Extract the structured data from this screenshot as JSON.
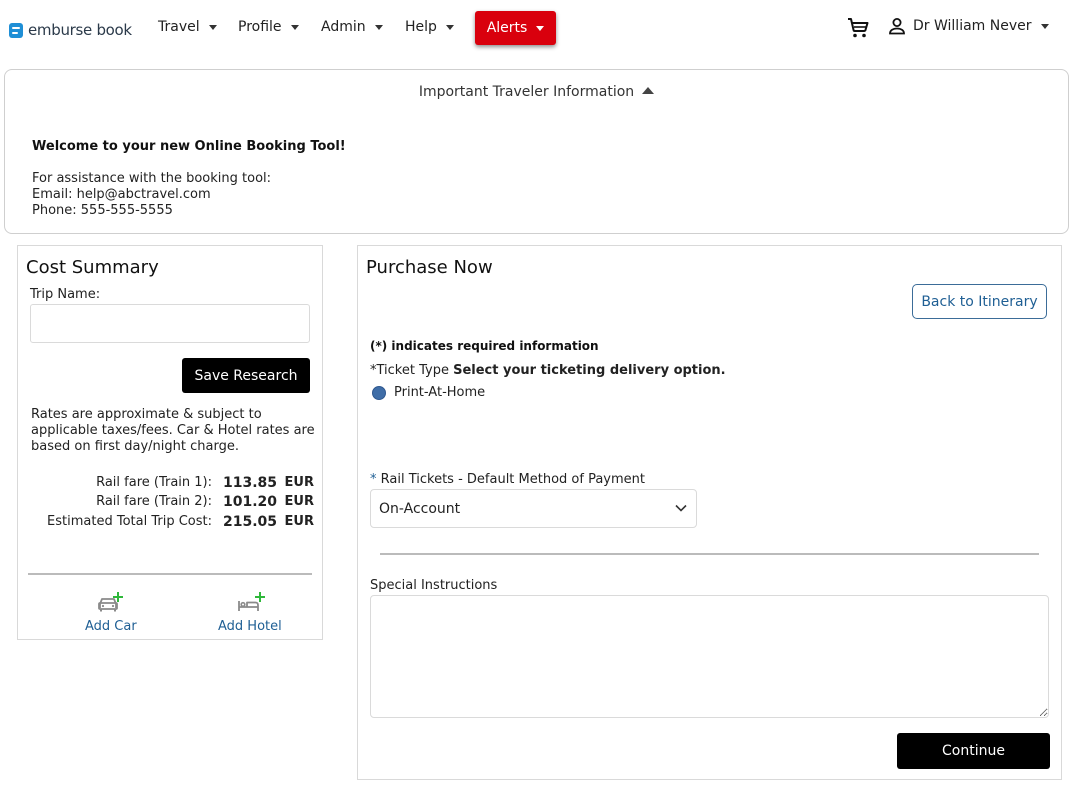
{
  "nav": {
    "logo_brand": "emburse",
    "logo_product": "book",
    "menu": [
      "Travel",
      "Profile",
      "Admin",
      "Help"
    ],
    "alerts_label": "Alerts",
    "user_name": "Dr William Never"
  },
  "info": {
    "title": "Important Traveler Information",
    "welcome": "Welcome to your new Online Booking Tool!",
    "assist_line": "For assistance with the booking tool:",
    "email_line": "Email:  help@abctravel.com",
    "phone_line": "Phone:  555-555-5555"
  },
  "cost_summary": {
    "title": "Cost Summary",
    "trip_name_label": "Trip Name:",
    "trip_name_value": "",
    "save_label": "Save Research",
    "note": "Rates are approximate & subject to applicable taxes/fees. Car & Hotel rates are based on first day/night charge.",
    "fares": [
      {
        "label": "Rail fare (Train 1):",
        "amount": "113.85",
        "currency": "EUR"
      },
      {
        "label": "Rail fare (Train 2):",
        "amount": "101.20",
        "currency": "EUR"
      },
      {
        "label": "Estimated Total Trip Cost:",
        "amount": "215.05",
        "currency": "EUR"
      }
    ],
    "add_car_label": "Add Car",
    "add_hotel_label": "Add Hotel"
  },
  "purchase": {
    "title": "Purchase Now",
    "back_label": "Back to Itinerary",
    "required_note": "(*) indicates required information",
    "ticket_type_prefix": "*Ticket Type",
    "ticket_type_instruction": "Select your ticketing delivery option.",
    "ticket_option": "Print-At-Home",
    "payment_label_ast": "*",
    "payment_label": "Rail Tickets - Default Method of Payment",
    "payment_value": "On-Account",
    "special_label": "Special Instructions",
    "special_value": "",
    "continue_label": "Continue"
  },
  "colors": {
    "alerts": "#d9000d",
    "link": "#1f5f94",
    "plus": "#2fb83a",
    "radio": "#3f6da7"
  }
}
